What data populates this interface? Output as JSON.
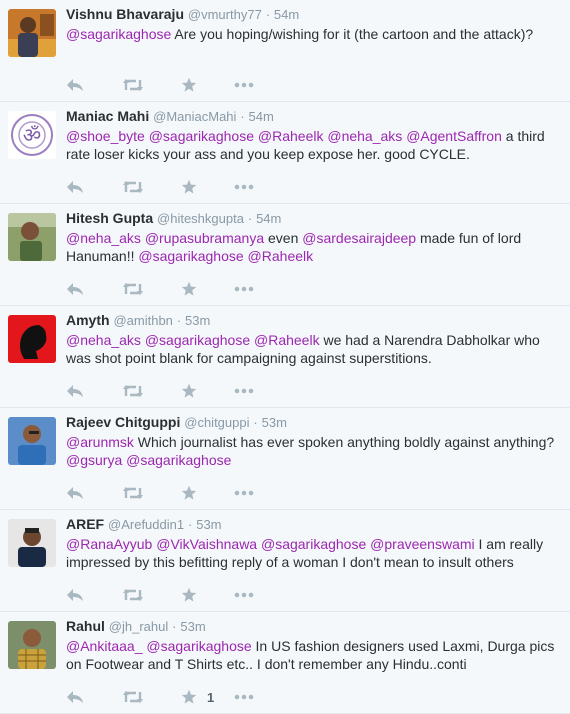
{
  "colors": {
    "mention": "#9c27b0",
    "icon": "#aab8c2",
    "separator": "#e1e8ed",
    "background": "#f5f8fa"
  },
  "tweets": [
    {
      "name": "Vishnu Bhavaraju",
      "handle": "@vmurthy77",
      "dot": "·",
      "time": "54m",
      "parts": [
        "",
        "@sagarikaghose",
        " Are you hoping/wishing for it (the cartoon and the attack)?"
      ],
      "avatar": "orange-photo",
      "favorites": ""
    },
    {
      "name": "Maniac Mahi",
      "handle": "@ManiacMahi",
      "dot": "·",
      "time": "54m",
      "parts": [
        "",
        "@shoe_byte",
        " ",
        "@sagarikaghose",
        " ",
        "@Raheelk",
        " ",
        "@neha_aks",
        " ",
        "@AgentSaffron",
        " a third rate loser kicks your ass and you keep expose her. good CYCLE."
      ],
      "avatar": "om-symbol",
      "favorites": ""
    },
    {
      "name": "Hitesh Gupta",
      "handle": "@hiteshkgupta",
      "dot": "·",
      "time": "54m",
      "parts": [
        "",
        "@neha_aks",
        " ",
        "@rupasubramanya",
        " even ",
        "@sardesairajdeep",
        " made fun of lord Hanuman!! ",
        "@sagarikaghose",
        " ",
        "@Raheelk",
        ""
      ],
      "avatar": "outdoor-photo",
      "favorites": ""
    },
    {
      "name": "Amyth",
      "handle": "@amithbn",
      "dot": "·",
      "time": "53m",
      "parts": [
        "",
        "@neha_aks",
        " ",
        "@sagarikaghose",
        " ",
        "@Raheelk",
        " we had a Narendra Dabholkar who was shot point blank for campaigning against superstitions."
      ],
      "avatar": "red-silhouette",
      "favorites": ""
    },
    {
      "name": "Rajeev Chitguppi",
      "handle": "@chitguppi",
      "dot": "·",
      "time": "53m",
      "parts": [
        "",
        "@arunmsk",
        " Which journalist has ever spoken anything boldly against anything? ",
        "@gsurya",
        " ",
        "@sagarikaghose",
        ""
      ],
      "avatar": "blue-shirt-photo",
      "favorites": ""
    },
    {
      "name": "AREF",
      "handle": "@Arefuddin1",
      "dot": "·",
      "time": "53m",
      "parts": [
        "",
        "@RanaAyyub",
        " ",
        "@VikVaishnawa",
        " ",
        "@sagarikaghose",
        " ",
        "@praveenswami",
        " I am really impressed by this befitting reply of a woman I don't mean to insult others"
      ],
      "avatar": "dark-shirt-photo",
      "favorites": ""
    },
    {
      "name": "Rahul",
      "handle": "@jh_rahul",
      "dot": "·",
      "time": "53m",
      "parts": [
        "",
        "@Ankitaaa_",
        " ",
        "@sagarikaghose",
        " In US fashion designers used Laxmi, Durga pics on Footwear and T Shirts etc.. I don't remember any Hindu..conti"
      ],
      "avatar": "checked-shirt-photo",
      "favorites": "1"
    }
  ]
}
